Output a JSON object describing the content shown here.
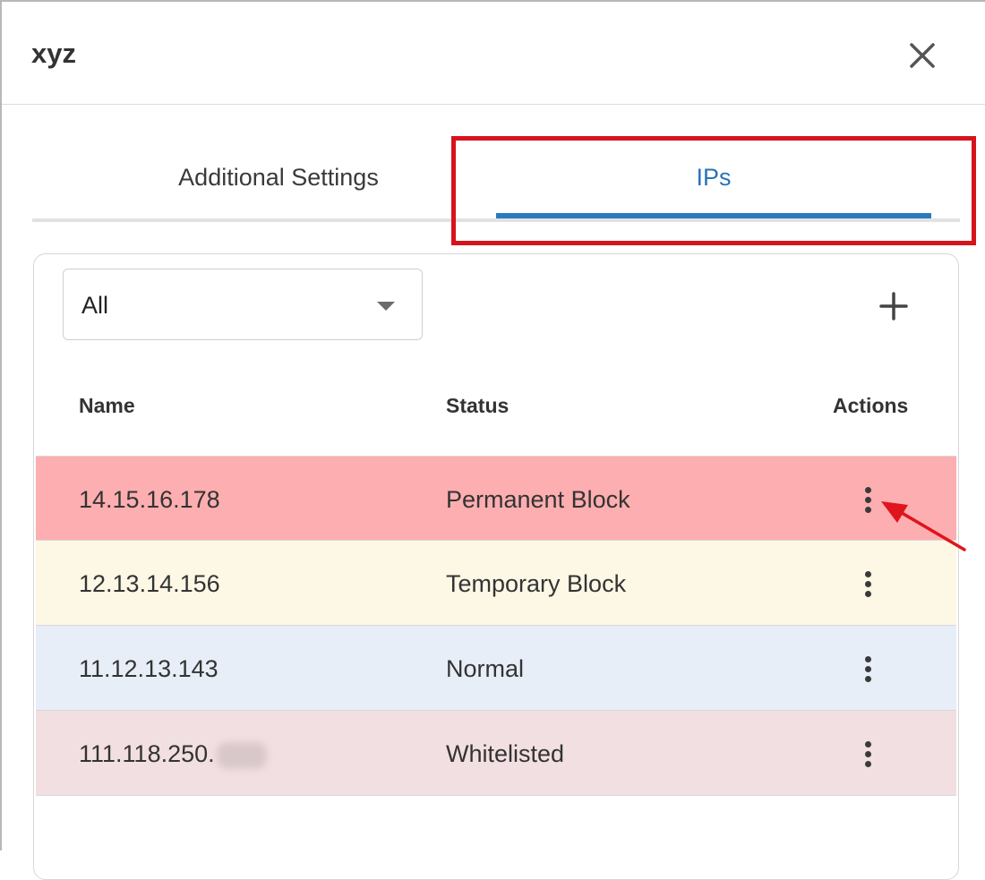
{
  "dialog": {
    "title": "xyz"
  },
  "tabs": [
    {
      "label": "Additional Settings",
      "active": false
    },
    {
      "label": "IPs",
      "active": true
    }
  ],
  "filter": {
    "selected": "All"
  },
  "table": {
    "columns": [
      "Name",
      "Status",
      "Actions"
    ],
    "rows": [
      {
        "name": "14.15.16.178",
        "status": "Permanent Block",
        "bg": "#fdaeb0"
      },
      {
        "name": "12.13.14.156",
        "status": "Temporary Block",
        "bg": "#fdf7e5"
      },
      {
        "name": "11.12.13.143",
        "status": "Normal",
        "bg": "#e7eef8"
      },
      {
        "name": "111.118.250.",
        "status": "Whitelisted",
        "bg": "#f2dfe1"
      }
    ]
  },
  "colors": {
    "accent": "#2a7abf",
    "highlight": "#d6141b"
  },
  "icons": {
    "close": "close-icon",
    "add": "plus-icon",
    "actions": "more-vertical-icon",
    "dropdown": "caret-down-icon"
  }
}
